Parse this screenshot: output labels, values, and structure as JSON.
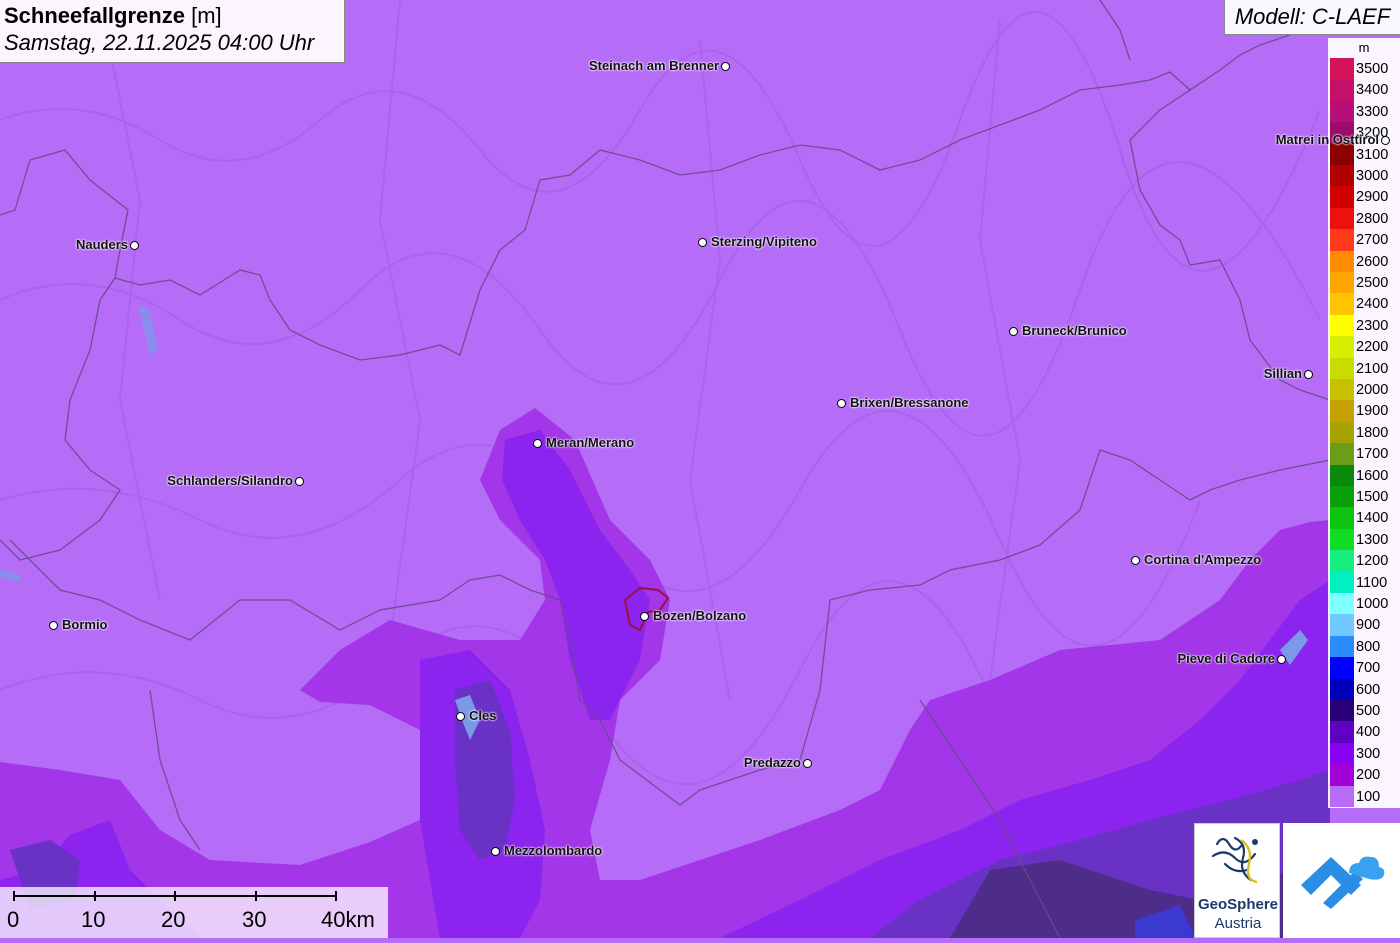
{
  "header": {
    "title_bold": "Schneefallgrenze",
    "title_unit": "[m]",
    "datetime": "Samstag, 22.11.2025 04:00 Uhr",
    "model": "Modell: C-LAEF"
  },
  "legend": {
    "unit": "m",
    "entries": [
      {
        "label": "3500",
        "color": "#d4145a"
      },
      {
        "label": "3400",
        "color": "#c5106a"
      },
      {
        "label": "3300",
        "color": "#b70e78"
      },
      {
        "label": "3200",
        "color": "#9e0a6e"
      },
      {
        "label": "3100",
        "color": "#8b0000"
      },
      {
        "label": "3000",
        "color": "#b00000"
      },
      {
        "label": "2900",
        "color": "#d10000"
      },
      {
        "label": "2800",
        "color": "#ee0f0f"
      },
      {
        "label": "2700",
        "color": "#ff3a1a"
      },
      {
        "label": "2600",
        "color": "#ff8c00"
      },
      {
        "label": "2500",
        "color": "#ffa500"
      },
      {
        "label": "2400",
        "color": "#ffc400"
      },
      {
        "label": "2300",
        "color": "#ffff00"
      },
      {
        "label": "2200",
        "color": "#d8ee00"
      },
      {
        "label": "2100",
        "color": "#c8dc00"
      },
      {
        "label": "2000",
        "color": "#c6c000"
      },
      {
        "label": "1900",
        "color": "#c6a000"
      },
      {
        "label": "1800",
        "color": "#a8a200"
      },
      {
        "label": "1700",
        "color": "#6a9e1a"
      },
      {
        "label": "1600",
        "color": "#0a8a0a"
      },
      {
        "label": "1500",
        "color": "#0aa00a"
      },
      {
        "label": "1400",
        "color": "#0ec40e"
      },
      {
        "label": "1300",
        "color": "#10dc28"
      },
      {
        "label": "1200",
        "color": "#18ee80"
      },
      {
        "label": "1100",
        "color": "#00f0c0"
      },
      {
        "label": "1000",
        "color": "#80ffff"
      },
      {
        "label": "900",
        "color": "#70c8ff"
      },
      {
        "label": "800",
        "color": "#2a8cff"
      },
      {
        "label": "700",
        "color": "#0000ff"
      },
      {
        "label": "600",
        "color": "#0000b8"
      },
      {
        "label": "500",
        "color": "#2a007a"
      },
      {
        "label": "400",
        "color": "#6000c0"
      },
      {
        "label": "300",
        "color": "#8a00f0"
      },
      {
        "label": "200",
        "color": "#a400d8"
      },
      {
        "label": "100",
        "color": "#b86cf6"
      }
    ]
  },
  "cities": [
    {
      "name": "Steinach am Brenner"
    },
    {
      "name": "Matrei in Osttirol"
    },
    {
      "name": "Nauders"
    },
    {
      "name": "Sterzing/Vipiteno"
    },
    {
      "name": "Bruneck/Brunico"
    },
    {
      "name": "Sillian"
    },
    {
      "name": "Brixen/Bressanone"
    },
    {
      "name": "Meran/Merano"
    },
    {
      "name": "Schlanders/Silandro"
    },
    {
      "name": "Cortina d'Ampezzo"
    },
    {
      "name": "Bormio"
    },
    {
      "name": "Bozen/Bolzano"
    },
    {
      "name": "Pieve di Cadore"
    },
    {
      "name": "Cles"
    },
    {
      "name": "Predazzo"
    },
    {
      "name": "Mezzolombardo"
    }
  ],
  "scale": {
    "labels": [
      "0",
      "10",
      "20",
      "30",
      "40km"
    ]
  },
  "logos": {
    "geosphere_line1": "GeoSphere",
    "geosphere_line2": "Austria"
  },
  "colors": {
    "field_100": "#b56cf6",
    "field_200": "#a233e6",
    "field_300": "#8a22ee",
    "field_400": "#6e2ec4",
    "field_500": "#4a2a90"
  }
}
